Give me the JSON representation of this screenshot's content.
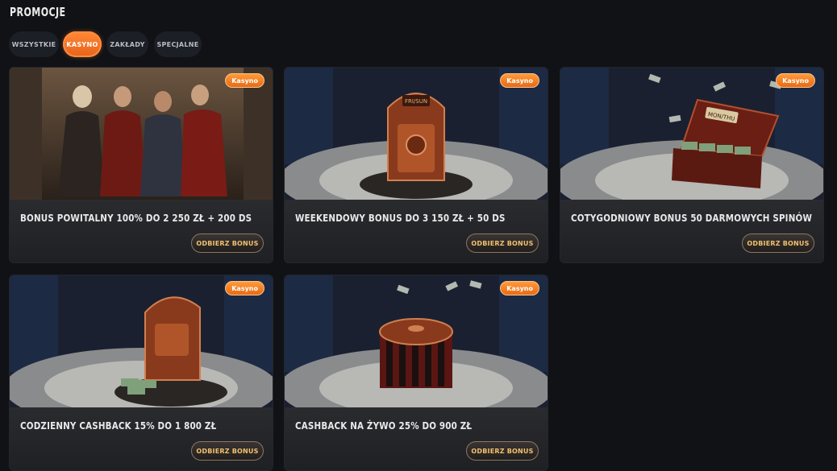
{
  "page": {
    "title": "PROMOCJE"
  },
  "tabs": [
    {
      "label": "WSZYSTKIE",
      "active": false
    },
    {
      "label": "KASYNO",
      "active": true
    },
    {
      "label": "ZAKŁADY",
      "active": false
    },
    {
      "label": "SPECJALNE",
      "active": false
    }
  ],
  "colors": {
    "accent": "#f07426",
    "background": "#101216",
    "card": "#1b1d22",
    "button_text": "#f0c070"
  },
  "promotions": [
    {
      "badge": "Kasyno",
      "title": "BONUS POWITALNY 100% DO 2 250 ZŁ + 200 DS",
      "button": "ODBIERZ BONUS",
      "image": "casino-characters"
    },
    {
      "badge": "Kasyno",
      "title": "WEEKENDOWY BONUS DO 3 150 ZŁ + 50 DS",
      "button": "ODBIERZ BONUS",
      "image": "fri-sun-slot-machine",
      "image_text": "FRI/SUN"
    },
    {
      "badge": "Kasyno",
      "title": "COTYGODNIOWY BONUS 50 DARMOWYCH SPINÓW",
      "button": "ODBIERZ BONUS",
      "image": "mon-thu-money-chest",
      "image_text": "MON/THU"
    },
    {
      "badge": "Kasyno",
      "title": "CODZIENNY CASHBACK 15% DO 1 800 ZŁ",
      "button": "ODBIERZ BONUS",
      "image": "cashback-slot-machine"
    },
    {
      "badge": "Kasyno",
      "title": "CASHBACK NA ŻYWO 25% DO 900 ZŁ",
      "button": "ODBIERZ BONUS",
      "image": "live-roulette"
    }
  ]
}
